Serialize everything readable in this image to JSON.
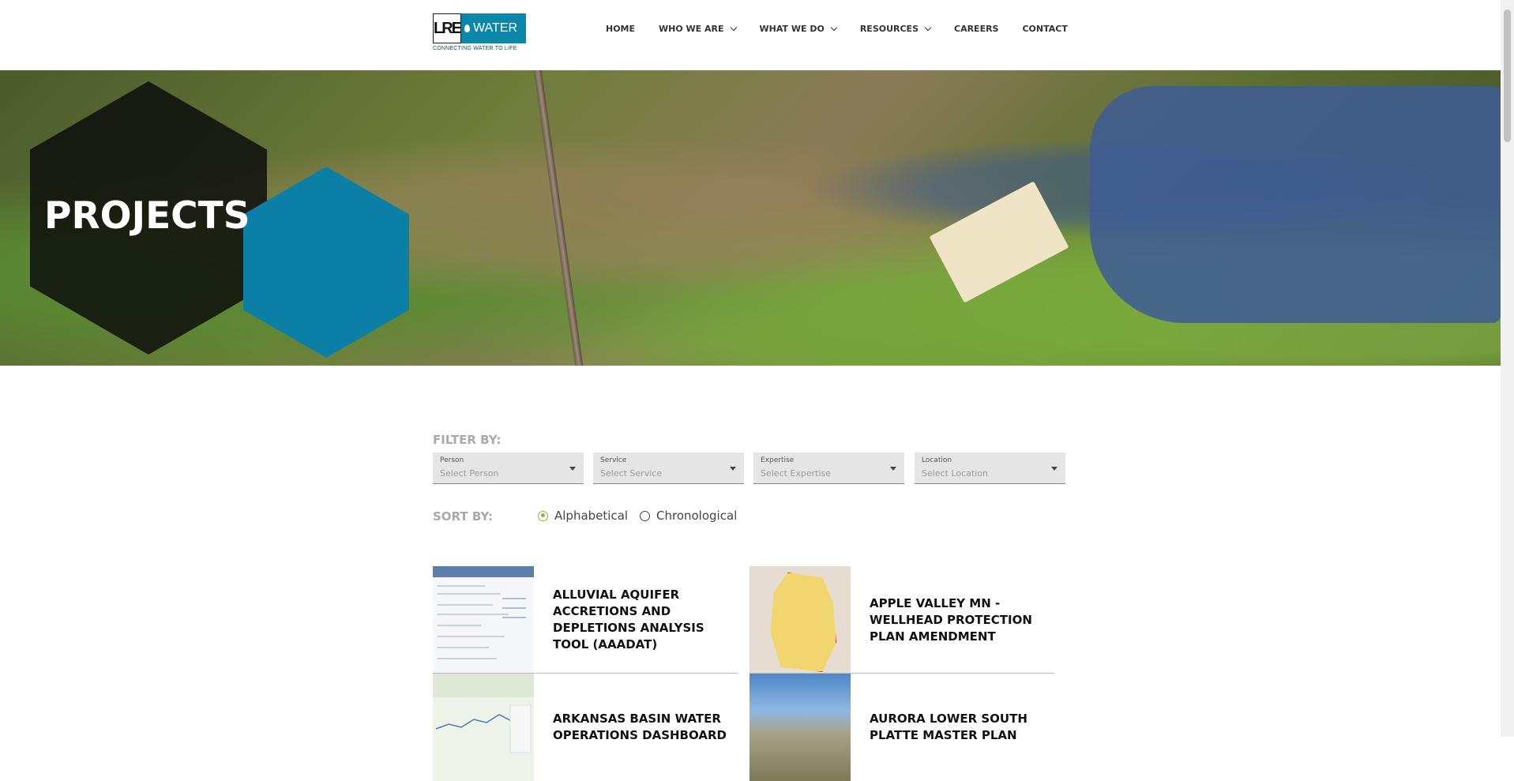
{
  "brand": {
    "logo_main": "LRE",
    "logo_word": "WATER",
    "tagline": "CONNECTING WATER TO LIFE"
  },
  "nav": [
    {
      "label": "HOME",
      "dropdown": false
    },
    {
      "label": "WHO WE ARE",
      "dropdown": true
    },
    {
      "label": "WHAT WE DO",
      "dropdown": true
    },
    {
      "label": "RESOURCES",
      "dropdown": true
    },
    {
      "label": "CAREERS",
      "dropdown": false
    },
    {
      "label": "CONTACT",
      "dropdown": false
    }
  ],
  "hero": {
    "title": "PROJECTS"
  },
  "filters": {
    "label": "FILTER BY:",
    "selects": [
      {
        "label": "Person",
        "placeholder": "Select Person"
      },
      {
        "label": "Service",
        "placeholder": "Select Service"
      },
      {
        "label": "Expertise",
        "placeholder": "Select Expertise"
      },
      {
        "label": "Location",
        "placeholder": "Select Location"
      }
    ]
  },
  "sort": {
    "label": "SORT BY:",
    "options": [
      {
        "label": "Alphabetical",
        "selected": true
      },
      {
        "label": "Chronological",
        "selected": false
      }
    ]
  },
  "projects": [
    {
      "title": "ALLUVIAL AQUIFER ACCRETIONS AND DEPLETIONS ANALYSIS TOOL (AAADAT)",
      "thumb": "screenshot"
    },
    {
      "title": "APPLE VALLEY MN - WELLHEAD PROTECTION PLAN AMENDMENT",
      "thumb": "map"
    },
    {
      "title": "ARKANSAS BASIN WATER OPERATIONS DASHBOARD",
      "thumb": "chart"
    },
    {
      "title": "AURORA LOWER SOUTH PLATTE MASTER PLAN",
      "thumb": "photo"
    }
  ],
  "colors": {
    "accent": "#0b87aa",
    "radio_on": "#8fb339",
    "hex_dark": "#0a0a0a"
  }
}
